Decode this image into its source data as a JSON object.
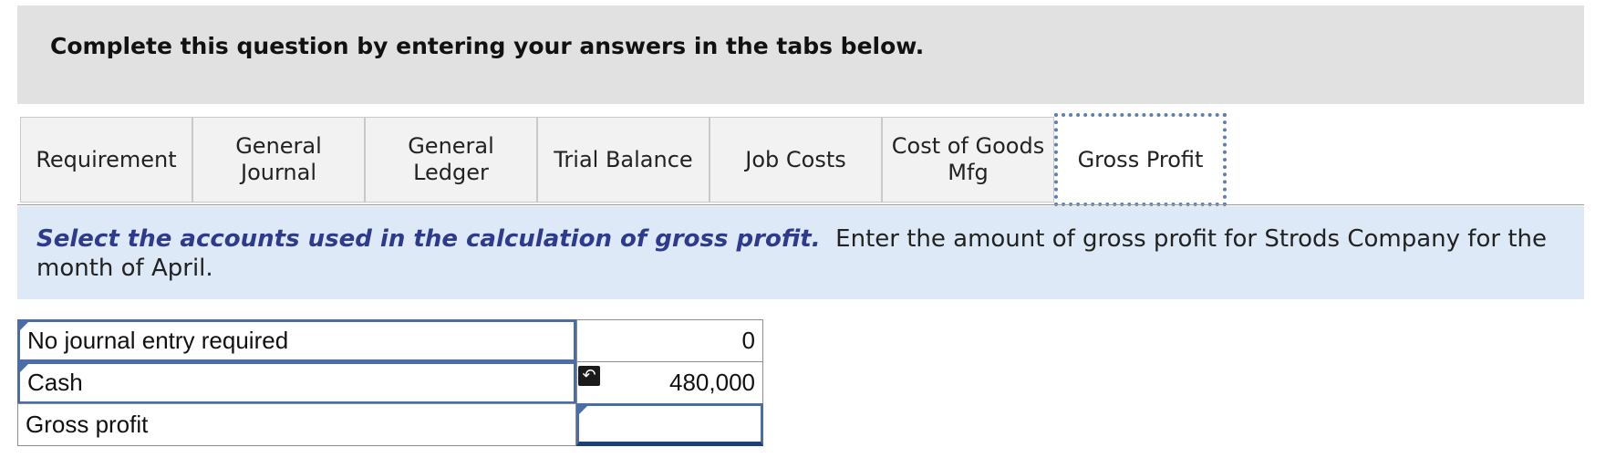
{
  "header": {
    "title": "Complete this question by entering your answers in the tabs below."
  },
  "tabs": [
    {
      "label": "Requirement"
    },
    {
      "label": "General\nJournal"
    },
    {
      "label": "General\nLedger"
    },
    {
      "label": "Trial Balance"
    },
    {
      "label": "Job Costs"
    },
    {
      "label": "Cost of Goods\nMfg"
    },
    {
      "label": "Gross Profit",
      "active": true
    }
  ],
  "instruction": {
    "emphasis": "Select the accounts used in the calculation of gross profit.",
    "text": "Enter the amount of gross profit for Strods Company for the month of April."
  },
  "table": {
    "rows": [
      {
        "account": "No journal entry required",
        "amount": "0"
      },
      {
        "account": "Cash",
        "amount": "480,000"
      },
      {
        "account": "Gross profit",
        "amount": ""
      }
    ]
  },
  "icons": {
    "undo": "undo-arrow-icon",
    "corner_marker": "dropdown-corner-marker-icon"
  },
  "colors": {
    "header_bg": "#e1e1e1",
    "instruction_bg": "#dde9f6",
    "instruction_emphasis": "#2e3a8c",
    "active_tab_border": "#5b7fb5",
    "field_border": "#4a6da8"
  }
}
